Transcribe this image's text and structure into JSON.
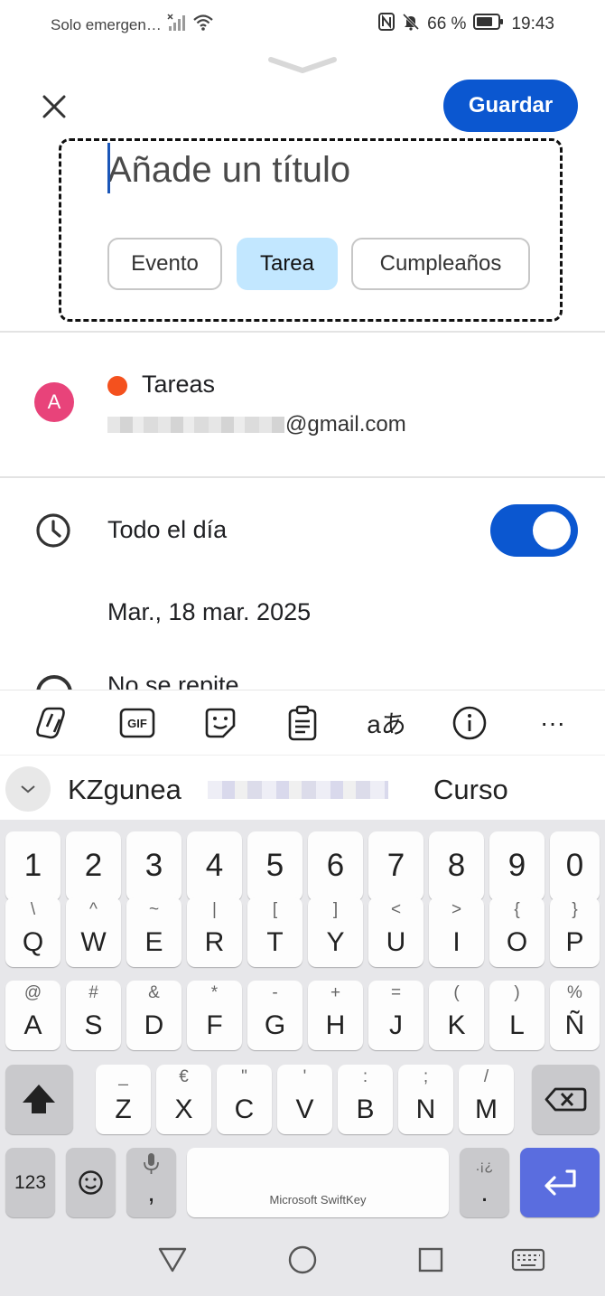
{
  "status_bar": {
    "carrier": "Solo emergen…",
    "battery": "66 %",
    "time": "19:43",
    "icons": [
      "nfc-icon",
      "mute-icon",
      "battery-icon",
      "wifi-icon",
      "signal-icon"
    ]
  },
  "header": {
    "close_icon": "close-icon",
    "save_label": "Guardar"
  },
  "title_field": {
    "placeholder": "Añade un título",
    "value": ""
  },
  "type_chips": [
    {
      "label": "Evento",
      "selected": false
    },
    {
      "label": "Tarea",
      "selected": true
    },
    {
      "label": "Cumpleaños",
      "selected": false
    }
  ],
  "calendar": {
    "avatar_letter": "A",
    "name": "Tareas",
    "color": "#f4511e",
    "email_suffix": "@gmail.com"
  },
  "schedule": {
    "all_day_label": "Todo el día",
    "all_day_on": true,
    "date": "Mar., 18 mar. 2025",
    "repeat_label": "No se repite"
  },
  "keyboard_toolbar": {
    "items": [
      "copilot-icon",
      "GIF",
      "sticker-icon",
      "clipboard-icon",
      "aあ",
      "info-icon",
      "···"
    ]
  },
  "suggestions": {
    "left": "KZgunea",
    "right": "Curso"
  },
  "keyboard": {
    "row_numbers": [
      "1",
      "2",
      "3",
      "4",
      "5",
      "6",
      "7",
      "8",
      "9",
      "0"
    ],
    "row1": [
      {
        "main": "Q",
        "sub": "\\"
      },
      {
        "main": "W",
        "sub": "^"
      },
      {
        "main": "E",
        "sub": "~"
      },
      {
        "main": "R",
        "sub": "|"
      },
      {
        "main": "T",
        "sub": "["
      },
      {
        "main": "Y",
        "sub": "]"
      },
      {
        "main": "U",
        "sub": "<"
      },
      {
        "main": "I",
        "sub": ">"
      },
      {
        "main": "O",
        "sub": "{"
      },
      {
        "main": "P",
        "sub": "}"
      }
    ],
    "row2": [
      {
        "main": "A",
        "sub": "@"
      },
      {
        "main": "S",
        "sub": "#"
      },
      {
        "main": "D",
        "sub": "&"
      },
      {
        "main": "F",
        "sub": "*"
      },
      {
        "main": "G",
        "sub": "-"
      },
      {
        "main": "H",
        "sub": "+"
      },
      {
        "main": "J",
        "sub": "="
      },
      {
        "main": "K",
        "sub": "("
      },
      {
        "main": "L",
        "sub": ")"
      },
      {
        "main": "Ñ",
        "sub": "%"
      }
    ],
    "row3": [
      {
        "main": "Z",
        "sub": "_"
      },
      {
        "main": "X",
        "sub": "€"
      },
      {
        "main": "C",
        "sub": "\""
      },
      {
        "main": "V",
        "sub": "'"
      },
      {
        "main": "B",
        "sub": ":"
      },
      {
        "main": "N",
        "sub": ";"
      },
      {
        "main": "M",
        "sub": "/"
      }
    ],
    "num_label": "123",
    "comma": ",",
    "period": ".",
    "period_sub": ".¡¿",
    "space_brand": "Microsoft SwiftKey",
    "accent_color": "#5a6ddf"
  },
  "nav": [
    "back-icon",
    "home-icon",
    "recents-icon",
    "keyboard-switch-icon"
  ]
}
